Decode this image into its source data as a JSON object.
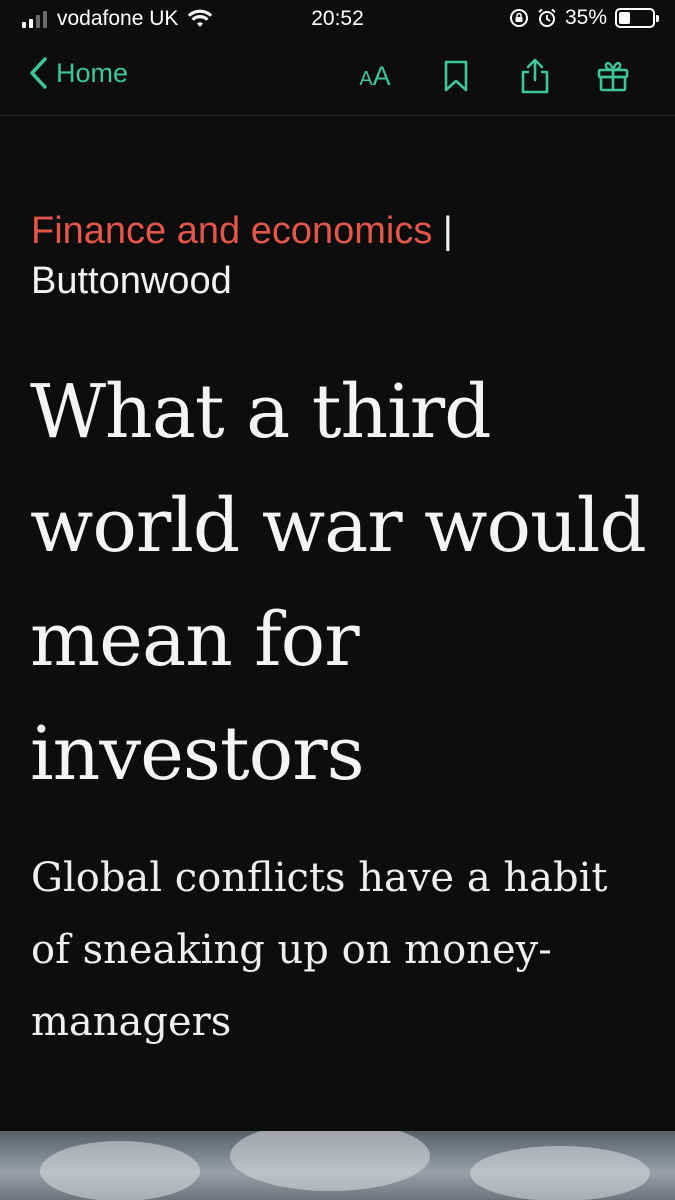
{
  "status_bar": {
    "carrier": "vodafone UK",
    "time": "20:52",
    "battery_percent": "35%",
    "battery_level": 0.35
  },
  "nav": {
    "back_label": "Home",
    "icons": [
      "chevron-left-icon",
      "font-size-icon",
      "bookmark-icon",
      "share-icon",
      "gift-icon"
    ],
    "font_size_small": "A",
    "font_size_big": "A",
    "accent_color": "#3fc59a"
  },
  "article": {
    "section": "Finance and economics",
    "separator": "|",
    "column": "Buttonwood",
    "headline": "What a third world war would mean for investors",
    "standfirst": "Global conflicts have a habit of sneaking up on money-managers",
    "section_color": "#e3574a"
  }
}
